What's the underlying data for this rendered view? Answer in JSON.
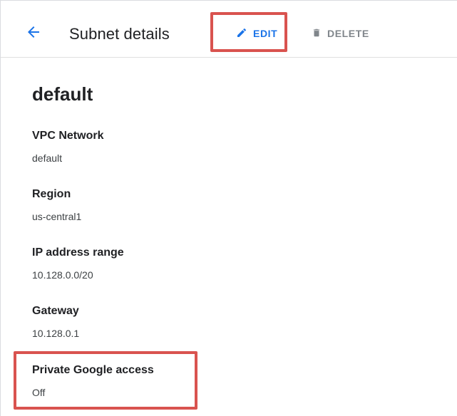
{
  "header": {
    "title": "Subnet details",
    "back_icon": "arrow-back-icon",
    "edit_label": "EDIT",
    "edit_icon": "pencil-icon",
    "delete_label": "DELETE",
    "delete_icon": "trash-icon"
  },
  "subnet": {
    "name": "default",
    "fields": [
      {
        "label": "VPC Network",
        "value": "default"
      },
      {
        "label": "Region",
        "value": "us-central1"
      },
      {
        "label": "IP address range",
        "value": "10.128.0.0/20"
      },
      {
        "label": "Gateway",
        "value": "10.128.0.1"
      },
      {
        "label": "Private Google access",
        "value": "Off"
      }
    ]
  },
  "colors": {
    "accent": "#1a73e8",
    "disabled": "#80868b",
    "highlight": "#d9534f"
  }
}
